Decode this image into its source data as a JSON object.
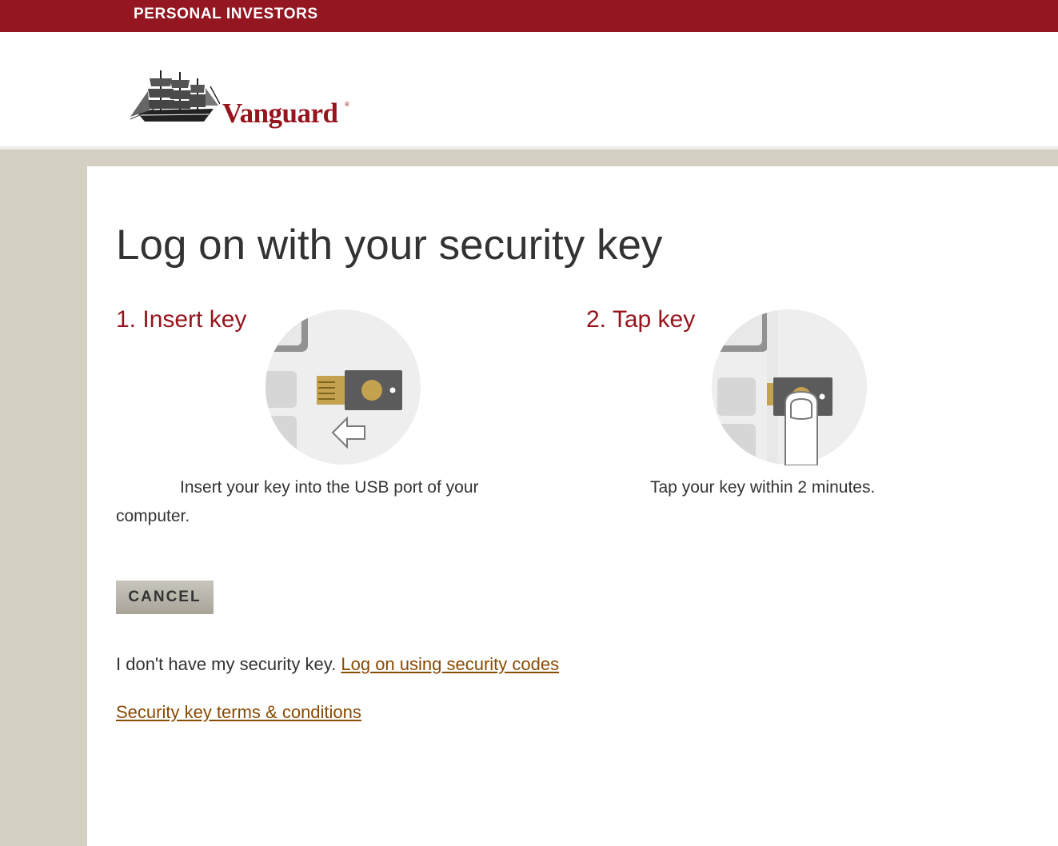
{
  "topbar": {
    "label": "PERSONAL INVESTORS"
  },
  "brand": {
    "name": "Vanguard",
    "registered_mark": "®"
  },
  "main": {
    "title": "Log on with your security key",
    "steps": [
      {
        "heading": "1. Insert key",
        "description": "Insert your key into the USB port of your computer.",
        "illustration": "insert-usb-key-illustration"
      },
      {
        "heading": "2. Tap key",
        "description": "Tap your key within 2 minutes.",
        "illustration": "tap-usb-key-illustration"
      }
    ],
    "cancel_label": "CANCEL",
    "no_key_text": "I don't have my security key.",
    "codes_link": "Log on using security codes",
    "terms_link": "Security key terms & conditions"
  },
  "colors": {
    "brand_red": "#931621",
    "heading_red": "#96151d",
    "link_brown": "#8a4a03",
    "tan_background": "#d4d0c4"
  }
}
